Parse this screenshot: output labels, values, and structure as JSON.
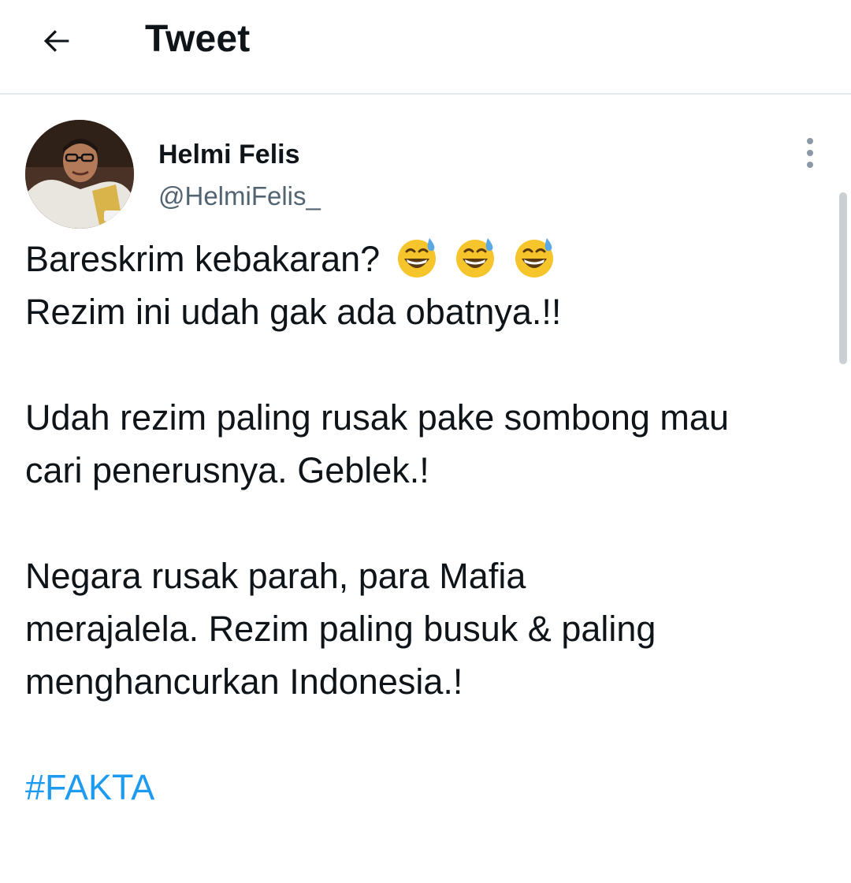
{
  "header": {
    "title": "Tweet",
    "back_icon": "arrow-left-icon"
  },
  "author": {
    "name": "Helmi Felis",
    "handle": "@HelmiFelis_",
    "avatar_icon": "avatar-photo"
  },
  "more_icon": "vertical-dots-icon",
  "tweet": {
    "line1": "Bareskrim kebakaran?",
    "line1_emoji": "grinning-face-with-sweat-emoji",
    "line2": "Rezim ini udah gak ada obatnya.!!",
    "line3": "Udah rezim paling rusak pake sombong mau",
    "line4": "cari penerusnya. Geblek.!",
    "line5": "Negara rusak parah, para Mafia",
    "line6": "merajalela. Rezim paling busuk & paling",
    "line7": "menghancurkan Indonesia.!",
    "hashtag": "#FAKTA"
  },
  "colors": {
    "link": "#1d9bf0",
    "secondary_text": "#536471",
    "primary_text": "#0f1419",
    "divider": "#e6e9eb"
  }
}
